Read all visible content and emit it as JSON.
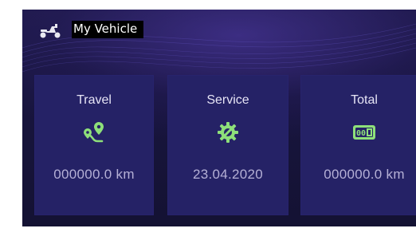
{
  "header": {
    "title": "My Vehicle",
    "icon": "scooter-icon"
  },
  "cards": [
    {
      "label": "Travel",
      "value": "000000.0 km",
      "icon": "route-pin-icon"
    },
    {
      "label": "Service",
      "value": "23.04.2020",
      "icon": "service-gear-icon"
    },
    {
      "label": "Total",
      "value": "000000.0 km",
      "icon": "odometer-icon"
    }
  ],
  "colors": {
    "accent": "#8ee07a",
    "card": "#252266",
    "background": "#18153e",
    "value_text": "#b5b0d6"
  }
}
